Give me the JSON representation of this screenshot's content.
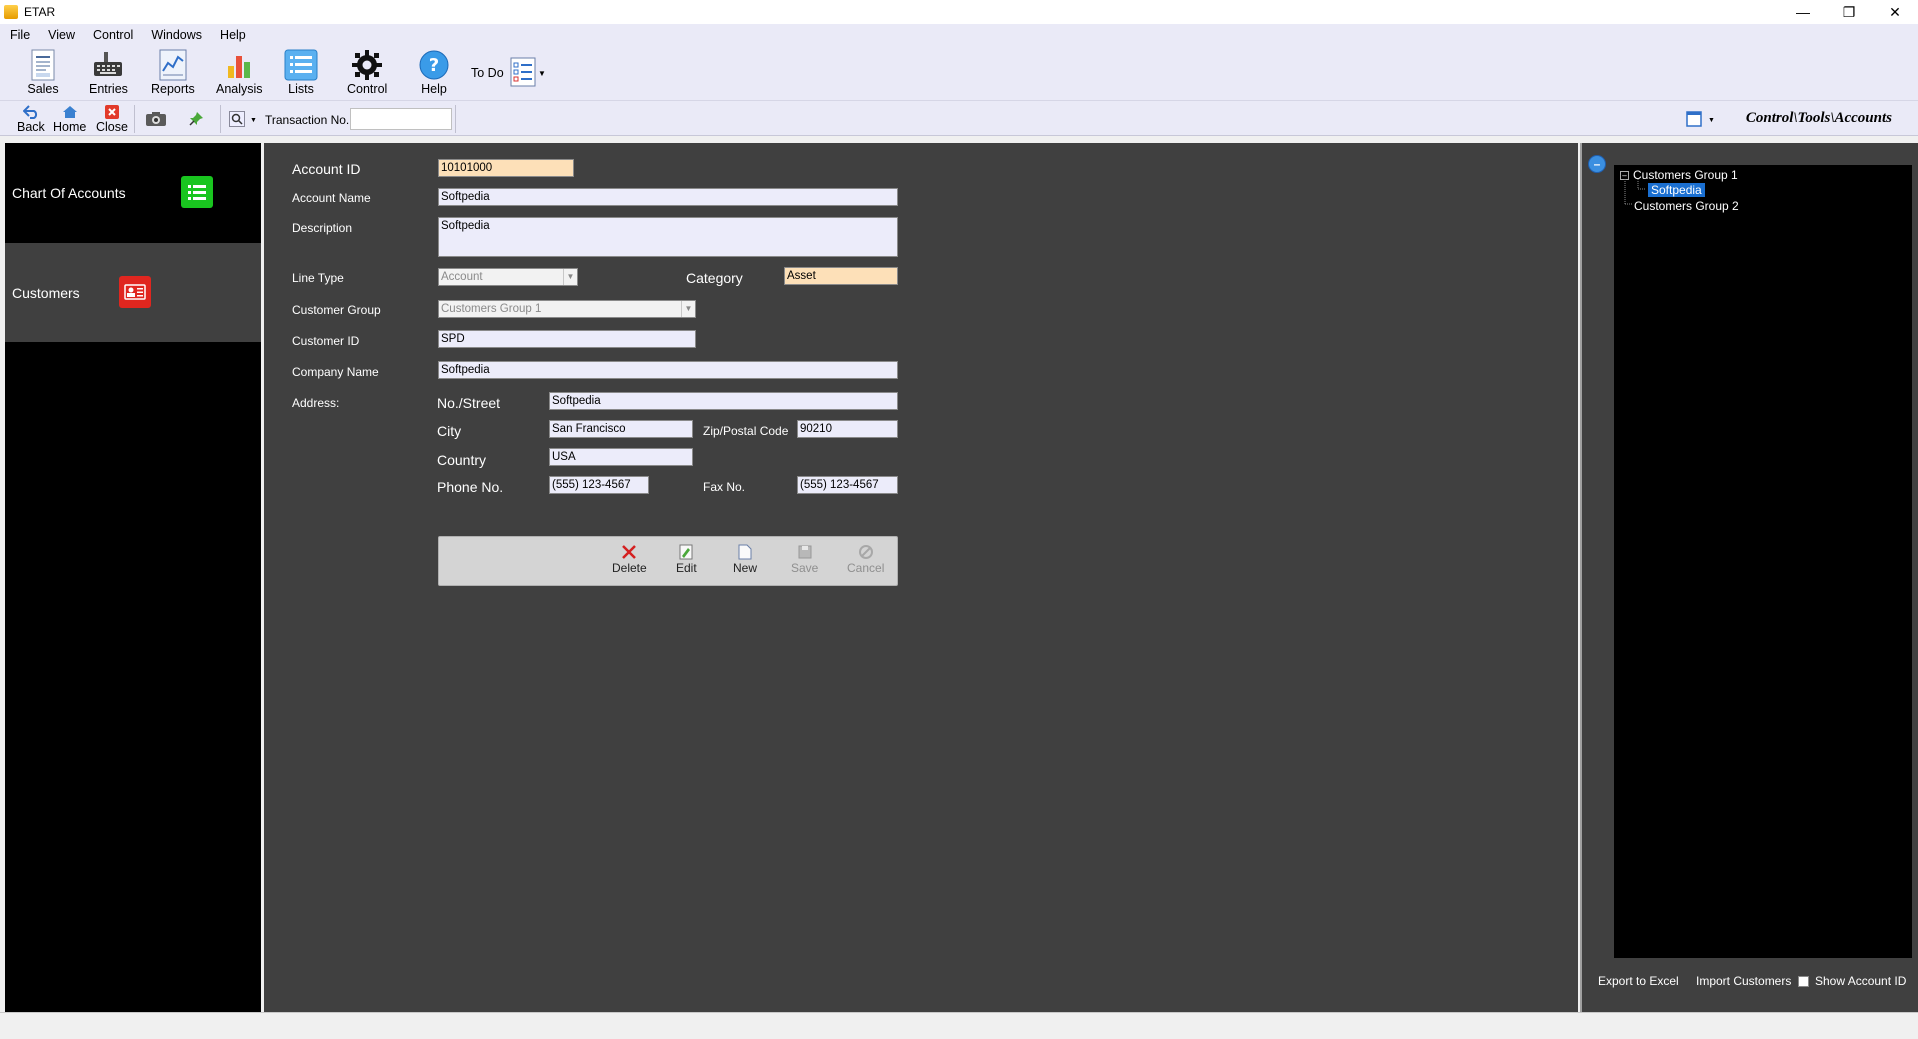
{
  "window": {
    "title": "ETAR"
  },
  "menu": [
    "File",
    "View",
    "Control",
    "Windows",
    "Help"
  ],
  "ribbon": {
    "sales": "Sales",
    "entries": "Entries",
    "reports": "Reports",
    "analysis": "Analysis",
    "lists": "Lists",
    "control": "Control",
    "help": "Help",
    "todo": "To Do"
  },
  "toolbar": {
    "back": "Back",
    "home": "Home",
    "close": "Close",
    "transaction_label": "Transaction No.",
    "transaction_value": "",
    "path": "Control\\Tools\\Accounts"
  },
  "nav": [
    {
      "label": "Chart Of Accounts",
      "icon": "list-icon",
      "color": "#19c51f"
    },
    {
      "label": "Customers",
      "icon": "contact-card-icon",
      "color": "#e0261f"
    }
  ],
  "form": {
    "account_id_label": "Account ID",
    "account_id": "10101000",
    "account_name_label": "Account Name",
    "account_name": "Softpedia",
    "description_label": "Description",
    "description": "Softpedia",
    "line_type_label": "Line Type",
    "line_type": "Account",
    "category_label": "Category",
    "category": "Asset",
    "customer_group_label": "Customer Group",
    "customer_group": "Customers Group 1",
    "customer_id_label": "Customer ID",
    "customer_id": "SPD",
    "company_name_label": "Company Name",
    "company_name": "Softpedia",
    "address_label": "Address:",
    "street_label": "No./Street",
    "street": "Softpedia",
    "city_label": "City",
    "city": "San Francisco",
    "zip_label": "Zip/Postal Code",
    "zip": "90210",
    "country_label": "Country",
    "country": "USA",
    "phone_label": "Phone No.",
    "phone": "(555) 123-4567",
    "fax_label": "Fax No.",
    "fax": "(555) 123-4567"
  },
  "actions": {
    "delete": "Delete",
    "edit": "Edit",
    "new": "New",
    "save": "Save",
    "cancel": "Cancel"
  },
  "tree": {
    "group1": "Customers Group 1",
    "child1": "Softpedia",
    "group2": "Customers Group 2"
  },
  "right_actions": {
    "export": "Export to Excel",
    "import": "Import Customers",
    "show_id": "Show Account ID"
  },
  "colors": {
    "accent": "#1a6fd1",
    "panel_bg": "#404040",
    "ribbon_bg": "#eaeaf7"
  }
}
